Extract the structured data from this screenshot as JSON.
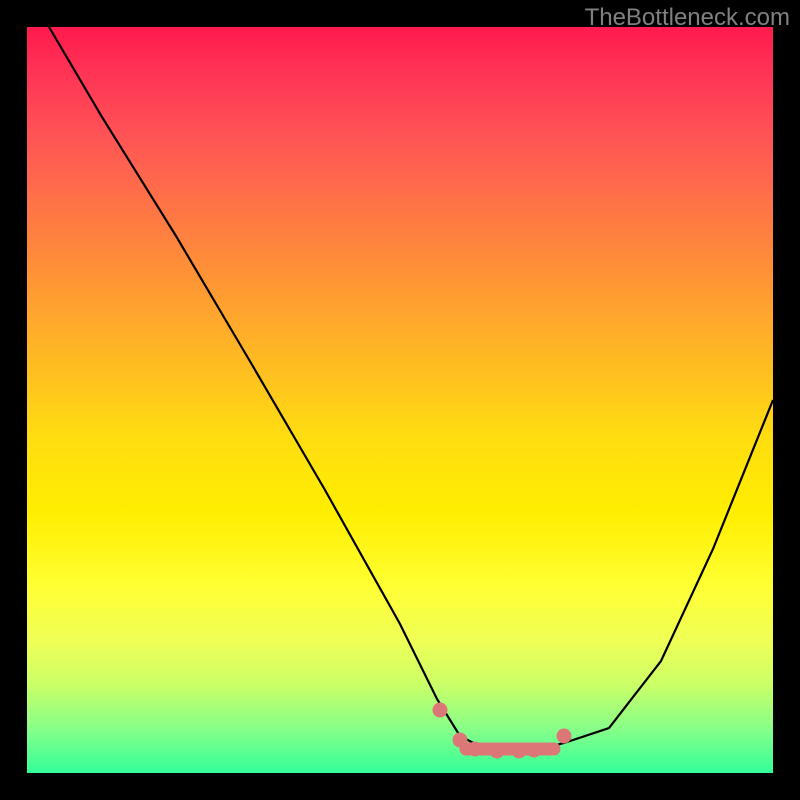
{
  "watermark": "TheBottleneck.com",
  "chart_data": {
    "type": "line",
    "title": "",
    "xlabel": "",
    "ylabel": "",
    "xlim": [
      0,
      100
    ],
    "ylim": [
      0,
      100
    ],
    "gradient_colors": {
      "top": "#ff1a4d",
      "middle": "#ffee00",
      "bottom": "#33ff99"
    },
    "series": [
      {
        "name": "bottleneck-curve",
        "type": "line",
        "color": "#000000",
        "stroke_width": 2,
        "x": [
          3,
          10,
          20,
          30,
          40,
          50,
          55,
          58,
          62,
          68,
          72,
          78,
          85,
          92,
          100
        ],
        "y": [
          100,
          88,
          72,
          55,
          38,
          20,
          10,
          5,
          3,
          3,
          4,
          6,
          15,
          30,
          50
        ]
      },
      {
        "name": "highlight-region",
        "type": "marker",
        "color": "#e67373",
        "x": [
          55,
          58,
          60,
          63,
          66,
          68,
          72
        ],
        "y": [
          8,
          4,
          3,
          3,
          3,
          3,
          5
        ]
      }
    ]
  }
}
